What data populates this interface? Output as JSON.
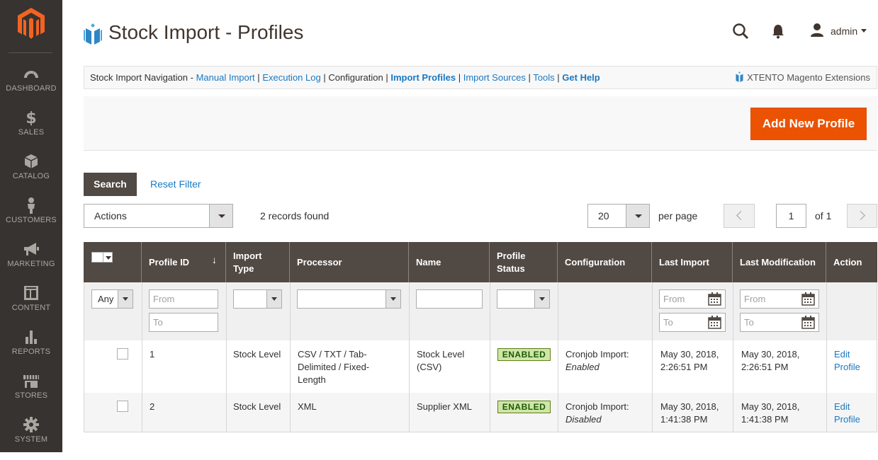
{
  "sidebar": {
    "items": [
      {
        "label": "DASHBOARD",
        "icon": "dashboard-icon"
      },
      {
        "label": "SALES",
        "icon": "dollar-icon"
      },
      {
        "label": "CATALOG",
        "icon": "box-icon"
      },
      {
        "label": "CUSTOMERS",
        "icon": "person-icon"
      },
      {
        "label": "MARKETING",
        "icon": "megaphone-icon"
      },
      {
        "label": "CONTENT",
        "icon": "layout-icon"
      },
      {
        "label": "REPORTS",
        "icon": "bar-chart-icon"
      },
      {
        "label": "STORES",
        "icon": "store-icon"
      },
      {
        "label": "SYSTEM",
        "icon": "gear-icon"
      }
    ]
  },
  "header": {
    "title": "Stock Import - Profiles",
    "user": "admin"
  },
  "navbar": {
    "prefix": "Stock Import Navigation -",
    "manual_import": "Manual Import",
    "execution_log": "Execution Log",
    "configuration": "Configuration",
    "import_profiles": "Import Profiles",
    "import_sources": "Import Sources",
    "tools": "Tools",
    "get_help": "Get Help",
    "sep": "|",
    "brand": "XTENTO Magento Extensions"
  },
  "actions_bar": {
    "add_button": "Add New Profile"
  },
  "toolbar": {
    "search": "Search",
    "reset_filter": "Reset Filter",
    "actions": "Actions",
    "records": "2 records found",
    "per_page_value": "20",
    "per_page_label": "per page",
    "page": "1",
    "of_pages": "of 1"
  },
  "columns": {
    "profile_id": "Profile ID",
    "sort_arrow": "↓",
    "import_type_1": "Import",
    "import_type_2": "Type",
    "processor": "Processor",
    "name": "Name",
    "status_1": "Profile",
    "status_2": "Status",
    "configuration": "Configuration",
    "last_import": "Last Import",
    "last_modification": "Last Modification",
    "action": "Action"
  },
  "filters": {
    "any": "Any",
    "from": "From",
    "to": "To"
  },
  "rows": [
    {
      "id": "1",
      "type": "Stock Level",
      "processor_1": "CSV / TXT / Tab-",
      "processor_2": "Delimited / Fixed-",
      "processor_3": "Length",
      "name_1": "Stock Level",
      "name_2": "(CSV)",
      "status": "ENABLED",
      "config_1": "Cronjob Import:",
      "config_2": "Enabled",
      "last_import_1": "May 30, 2018,",
      "last_import_2": "2:26:51 PM",
      "last_mod_1": "May 30, 2018,",
      "last_mod_2": "2:26:51 PM",
      "action_1": "Edit",
      "action_2": "Profile"
    },
    {
      "id": "2",
      "type": "Stock Level",
      "processor_1": "XML",
      "name_1": "Supplier XML",
      "status": "ENABLED",
      "config_1": "Cronjob Import:",
      "config_2": "Disabled",
      "last_import_1": "May 30, 2018,",
      "last_import_2": "1:41:38 PM",
      "last_mod_1": "May 30, 2018,",
      "last_mod_2": "1:41:38 PM",
      "action_1": "Edit",
      "action_2": "Profile"
    }
  ],
  "colors": {
    "sidebar_bg": "#373330",
    "accent": "#eb5202",
    "link": "#1979c3",
    "grid_header": "#514943",
    "badge_bg": "#d0e5a9"
  }
}
